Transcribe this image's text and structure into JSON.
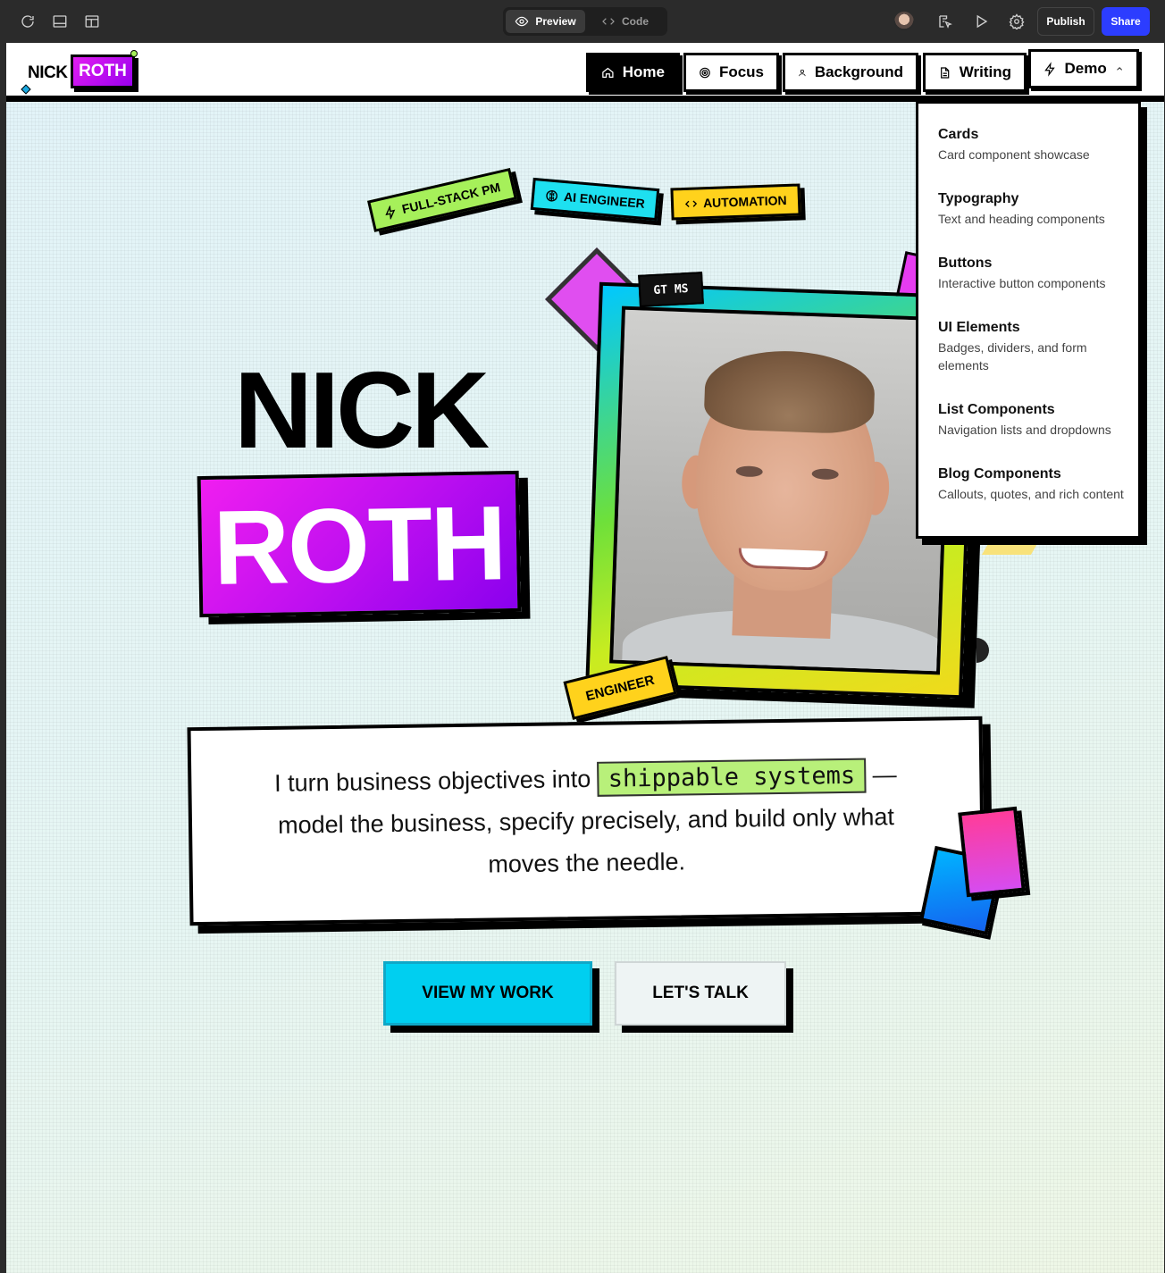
{
  "editor": {
    "mode_preview": "Preview",
    "mode_code": "Code",
    "publish_label": "Publish",
    "share_label": "Share",
    "accent_color": "#2c3dff"
  },
  "header": {
    "logo_nick": "NICK",
    "logo_roth": "ROTH",
    "nav": [
      {
        "label": "Home",
        "icon": "home-icon",
        "active": true
      },
      {
        "label": "Focus",
        "icon": "target-icon",
        "active": false
      },
      {
        "label": "Background",
        "icon": "user-icon",
        "active": false
      },
      {
        "label": "Writing",
        "icon": "document-icon",
        "active": false
      },
      {
        "label": "Demo",
        "icon": "lightning-icon",
        "active": false
      }
    ]
  },
  "dropdown": {
    "items": [
      {
        "title": "Cards",
        "desc": "Card component showcase"
      },
      {
        "title": "Typography",
        "desc": "Text and heading components"
      },
      {
        "title": "Buttons",
        "desc": "Interactive button components"
      },
      {
        "title": "UI Elements",
        "desc": "Badges, dividers, and form elements"
      },
      {
        "title": "List Components",
        "desc": "Navigation lists and dropdowns"
      },
      {
        "title": "Blog Components",
        "desc": "Callouts, quotes, and rich content"
      }
    ]
  },
  "hero": {
    "tags": [
      {
        "label": "FULL-STACK PM",
        "icon": "lightning-icon",
        "color": "#a6f05a"
      },
      {
        "label": "AI ENGINEER",
        "icon": "brain-icon",
        "color": "#1ee0f0"
      },
      {
        "label": "AUTOMATION",
        "icon": "code-icon",
        "color": "#ffd21c"
      }
    ],
    "name_first": "NICK",
    "name_last": "ROTH",
    "photo_badge": "GT MS",
    "engineer_tag": "ENGINEER",
    "tagline_before": "I turn business objectives into",
    "tagline_highlight": "shippable systems",
    "tagline_after": "— model the business, specify precisely, and build only what moves the needle.",
    "cta_primary": "VIEW MY WORK",
    "cta_secondary": "LET'S TALK"
  }
}
